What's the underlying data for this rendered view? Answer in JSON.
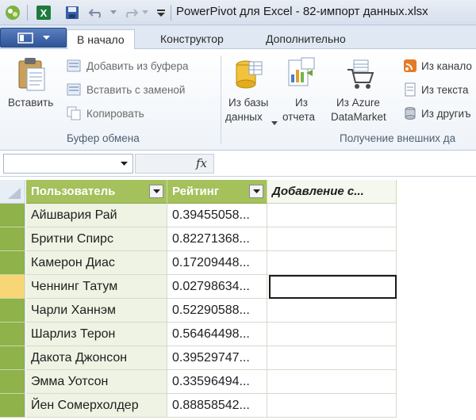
{
  "window": {
    "title": "PowerPivot для Excel - 82-импорт данных.xlsx"
  },
  "tabs": [
    {
      "label": "В начало",
      "active": true
    },
    {
      "label": "Конструктор",
      "active": false
    },
    {
      "label": "Дополнительно",
      "active": false
    }
  ],
  "clipboard": {
    "paste_label": "Вставить",
    "add_from_buffer": "Добавить из буфера",
    "paste_replace": "Вставить с заменой",
    "copy": "Копировать",
    "group_label": "Буфер обмена"
  },
  "external": {
    "from_db_line1": "Из базы",
    "from_db_line2": "данных",
    "from_report_line1": "Из",
    "from_report_line2": "отчета",
    "from_azure_line1": "Из Azure",
    "from_azure_line2": "DataMarket",
    "from_channel": "Из канало",
    "from_text": "Из текста",
    "from_other": "Из другиъ",
    "group_label": "Получение внешних да"
  },
  "formula_bar": {
    "fx_label": "fx"
  },
  "table": {
    "columns": [
      "Пользователь",
      "Рейтинг",
      "Добавление с..."
    ],
    "selected_row_index": 3,
    "rows": [
      {
        "user": "Айшвария Рай",
        "rating": "0.39455058..."
      },
      {
        "user": "Бритни Спирс",
        "rating": "0.82271368..."
      },
      {
        "user": "Камерон Диас",
        "rating": "0.17209448..."
      },
      {
        "user": "Ченнинг Татум",
        "rating": "0.02798634..."
      },
      {
        "user": "Чарли Ханнэм",
        "rating": "0.52290588..."
      },
      {
        "user": "Шарлиз Терон",
        "rating": "0.56464498..."
      },
      {
        "user": "Дакота Джонсон",
        "rating": "0.39529747..."
      },
      {
        "user": "Эмма Уотсон",
        "rating": "0.33596494..."
      },
      {
        "user": "Йен Сомерхолдер",
        "rating": "0.88858542..."
      }
    ]
  },
  "colors": {
    "header_green": "#a4c15c",
    "row_header_green": "#8fb24a",
    "selected_row": "#f7d775"
  }
}
